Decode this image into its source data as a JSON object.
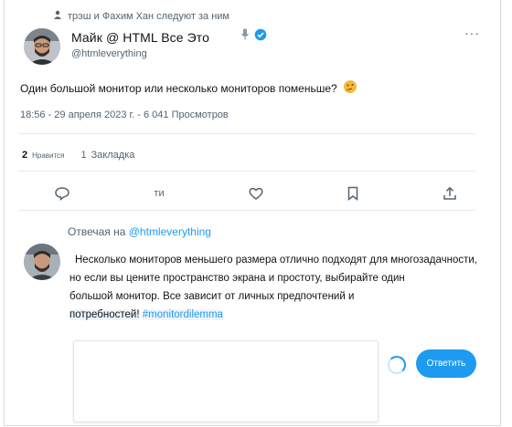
{
  "social_context": {
    "text": "трэш и Фахим Хан следуют за ним",
    "icon": "person-icon"
  },
  "author": {
    "name": "Майк @ HTML Все Это",
    "handle": "@htmleverything",
    "mic_icon": "microphone-icon",
    "verified_icon": "verified-badge-icon",
    "more_label": "···"
  },
  "tweet": {
    "text": "Один большой монитор или несколько мониторов поменьше?",
    "emoji": "🤔",
    "meta": "18:56 - 29 апреля 2023 г. - 6 041 Просмотров"
  },
  "stats": {
    "likes_count": "2",
    "likes_label": "Нравится",
    "bookmarks_count": "1",
    "bookmarks_label": "Закладка"
  },
  "actions": {
    "reply_icon": "reply-icon",
    "retweet_label": "ти",
    "like_icon": "heart-icon",
    "bookmark_icon": "bookmark-icon",
    "share_icon": "share-icon"
  },
  "reply": {
    "prefix": "Отвечая на",
    "handle": "@htmleverything",
    "line1": "Несколько мониторов меньшего размера отлично подходят для многозадачности,",
    "line2": "но если вы цените пространство экрана и простоту, выбирайте один",
    "line3": "большой монитор. Все зависит от личных предпочтений и",
    "line4_text": "потребностей!",
    "hashtag": "#monitordilemma",
    "input_placeholder": "",
    "button_label": "Ответить"
  },
  "colors": {
    "accent": "#1d9bf0",
    "text": "#0f1419",
    "muted": "#536471"
  }
}
